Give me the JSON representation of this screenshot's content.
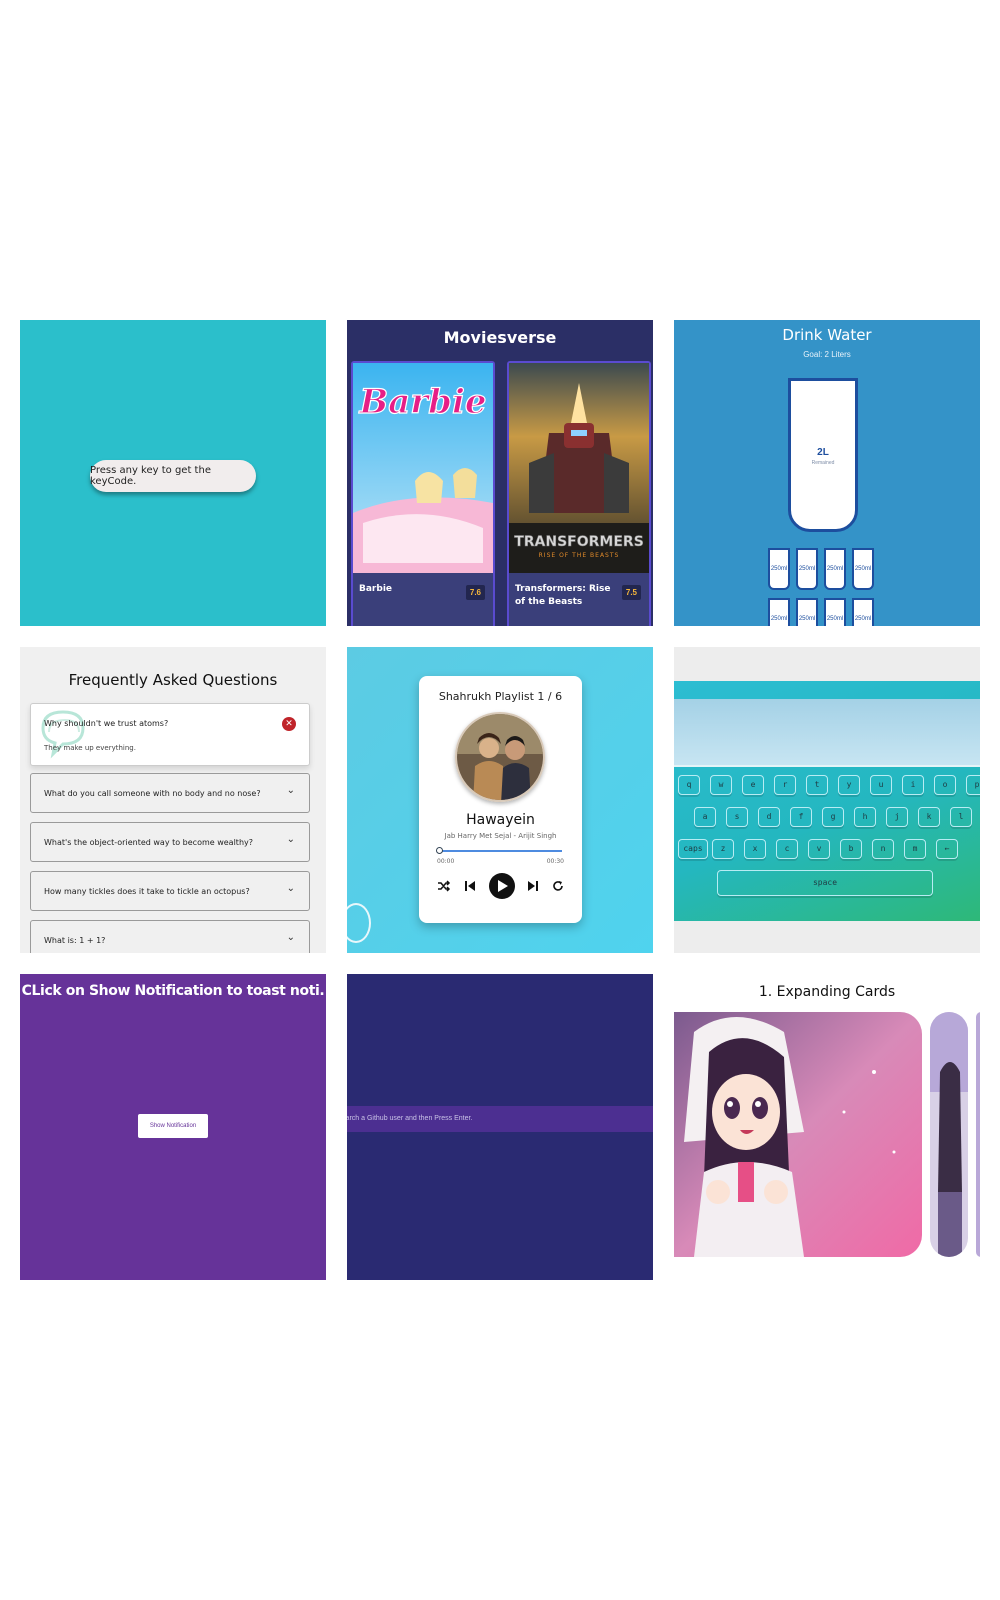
{
  "keycode": {
    "prompt": "Press any key to get the keyCode."
  },
  "moviesverse": {
    "title": "Moviesverse",
    "movies": [
      {
        "logo": "Barbie",
        "title": "Barbie",
        "rating": "7.6"
      },
      {
        "logo": "TRANSFORMERS",
        "tagline": "RISE OF THE BEASTS",
        "title": "Transformers: Rise of the Beasts",
        "rating": "7.5"
      }
    ]
  },
  "drink_water": {
    "title": "Drink Water",
    "goal": "Goal: 2 Liters",
    "remaining_value": "2L",
    "remaining_label": "Remained",
    "glasses": [
      "250ml",
      "250ml",
      "250ml",
      "250ml",
      "250ml",
      "250ml",
      "250ml",
      "250ml"
    ]
  },
  "faq": {
    "title": "Frequently Asked Questions",
    "items": [
      {
        "question": "Why shouldn't we trust atoms?",
        "answer": "They make up everything.",
        "open": true
      },
      {
        "question": "What do you call someone with no body and no nose?",
        "open": false
      },
      {
        "question": "What's the object-oriented way to become wealthy?",
        "open": false
      },
      {
        "question": "How many tickles does it take to tickle an octopus?",
        "open": false
      },
      {
        "question": "What is: 1 + 1?",
        "open": false
      }
    ]
  },
  "music_player": {
    "playlist": "Shahrukh Playlist 1 / 6",
    "song": "Hawayein",
    "artist": "Jab Harry Met Sejal - Arijit Singh",
    "current_time": "00:00",
    "duration": "00:30",
    "progress": 0
  },
  "keyboard": {
    "rows": [
      [
        "q",
        "w",
        "e",
        "r",
        "t",
        "y",
        "u",
        "i",
        "o",
        "p"
      ],
      [
        "a",
        "s",
        "d",
        "f",
        "g",
        "h",
        "j",
        "k",
        "l"
      ],
      [
        "caps",
        "z",
        "x",
        "c",
        "v",
        "b",
        "n",
        "m",
        "←"
      ]
    ],
    "space": "space"
  },
  "toast": {
    "title": "CLick on Show Notification to toast noti.",
    "button": "Show Notification"
  },
  "github": {
    "placeholder": "Search a Github user and then Press Enter."
  },
  "expanding_cards": {
    "title": "1. Expanding Cards"
  },
  "colors": {
    "keycode_bg": "#2bbfcb",
    "movies_bg": "#2b2f66",
    "water_bg": "#3493c8",
    "faq_bg": "#f0f0f0",
    "toast_bg": "#663399",
    "github_bg": "#2a2a72"
  }
}
